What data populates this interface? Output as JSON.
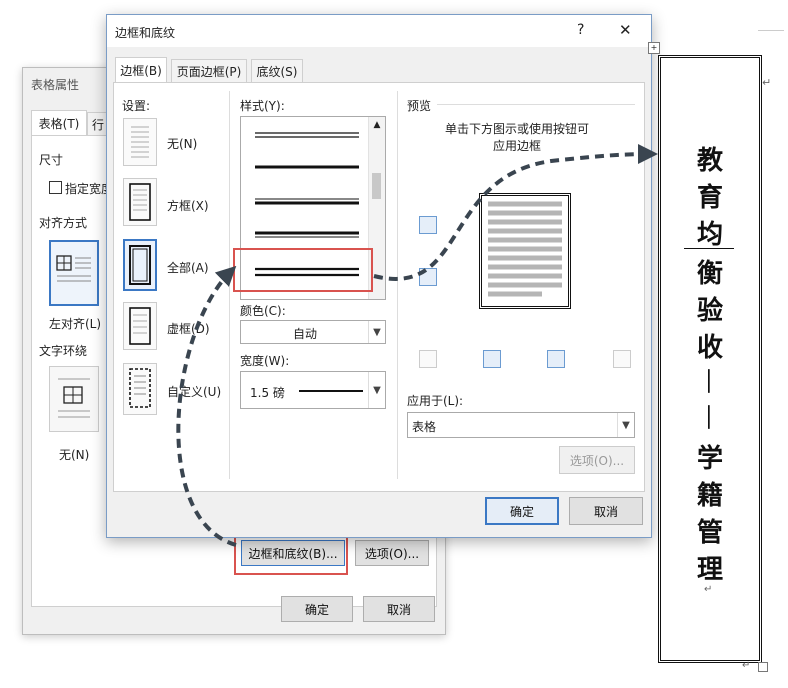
{
  "back_dialog": {
    "title": "表格属性",
    "tabs": [
      "表格(T)",
      "行"
    ],
    "size_label": "尺寸",
    "preferred_width": "指定宽度",
    "align_label": "对齐方式",
    "align_left": "左对齐(L)",
    "wrap_label": "文字环绕",
    "wrap_none": "无(N)",
    "borders_button": "边框和底纹(B)...",
    "options_button": "选项(O)...",
    "ok": "确定",
    "cancel": "取消"
  },
  "dialog": {
    "title": "边框和底纹",
    "help": "?",
    "close": "✕",
    "tabs": [
      "边框(B)",
      "页面边框(P)",
      "底纹(S)"
    ],
    "settings_label": "设置:",
    "settings": [
      "无(N)",
      "方框(X)",
      "全部(A)",
      "虚框(D)",
      "自定义(U)"
    ],
    "style_label": "样式(Y):",
    "color_label": "颜色(C):",
    "color_value": "自动",
    "width_label": "宽度(W):",
    "width_value": "1.5 磅",
    "preview_label": "预览",
    "preview_hint": "单击下方图示或使用按钮可\n应用边框",
    "apply_label": "应用于(L):",
    "apply_value": "表格",
    "options_button": "选项(O)...",
    "ok": "确定",
    "cancel": "取消"
  },
  "vertical_text": {
    "top": [
      "教",
      "育",
      "均",
      "衡",
      "验",
      "收"
    ],
    "dash1": "—",
    "dash2": "—",
    "bottom": [
      "学",
      "籍",
      "管",
      "理"
    ]
  }
}
